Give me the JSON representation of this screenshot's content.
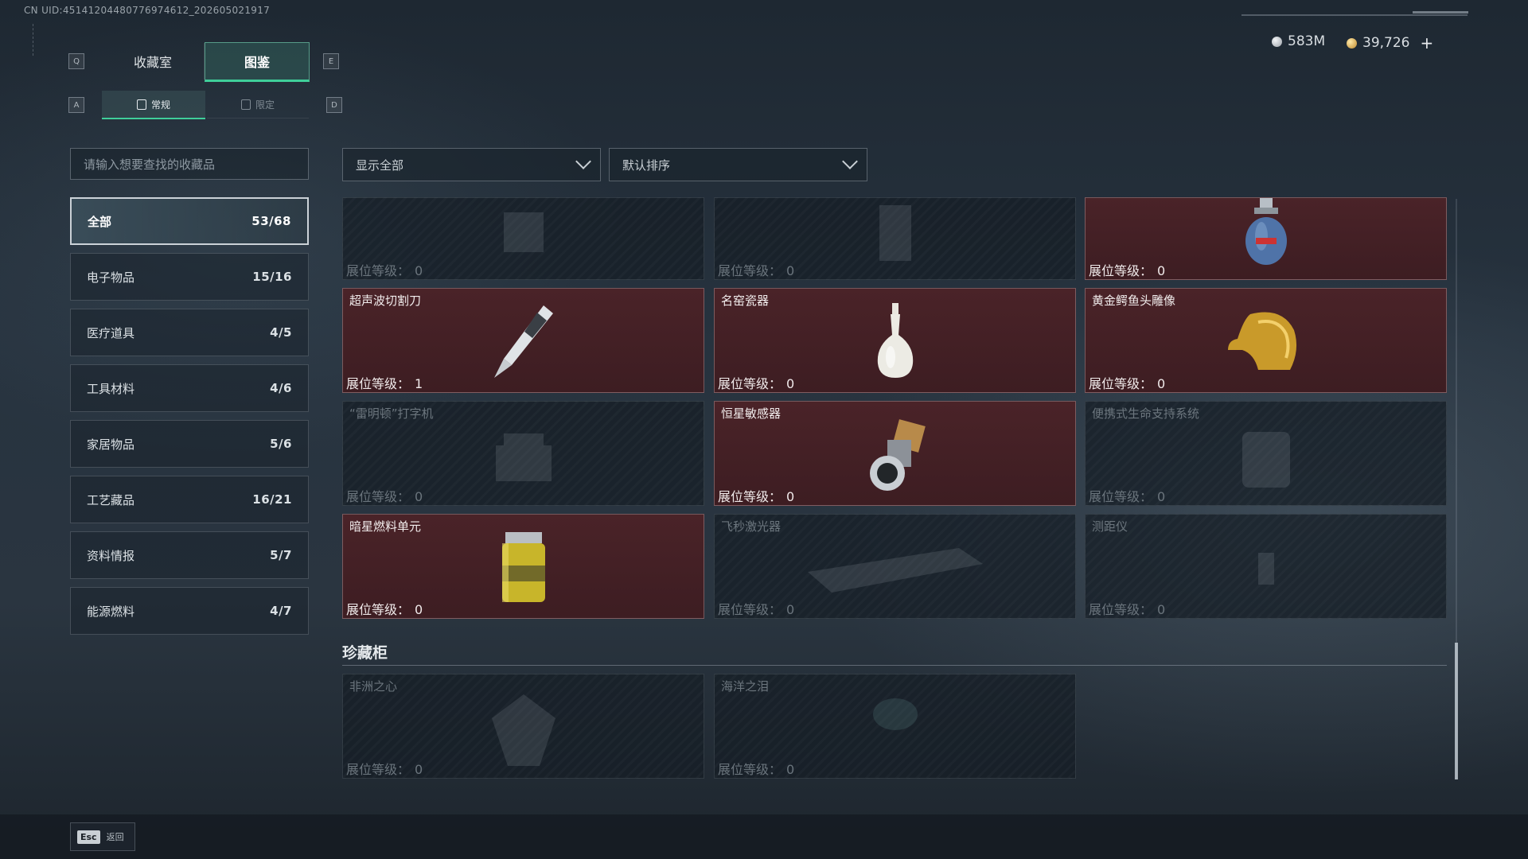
{
  "uid": "CN UID:4514120448077697461​2_202605021917",
  "currency": {
    "silver": "583M",
    "gold": "39,726",
    "plus": "+"
  },
  "keys": {
    "prev_tab": "Q",
    "next_tab": "E",
    "prev_sub": "A",
    "next_sub": "D"
  },
  "tabs": [
    {
      "label": "收藏室"
    },
    {
      "label": "图鉴"
    }
  ],
  "subtabs": [
    {
      "label": "常规"
    },
    {
      "label": "限定"
    }
  ],
  "search": {
    "placeholder": "请输入想要查找的收藏品"
  },
  "categories": [
    {
      "label": "全部",
      "count": "53/68"
    },
    {
      "label": "电子物品",
      "count": "15/16"
    },
    {
      "label": "医疗道具",
      "count": "4/5"
    },
    {
      "label": "工具材料",
      "count": "4/6"
    },
    {
      "label": "家居物品",
      "count": "5/6"
    },
    {
      "label": "工艺藏品",
      "count": "16/21"
    },
    {
      "label": "资料情报",
      "count": "5/7"
    },
    {
      "label": "能源燃料",
      "count": "4/7"
    }
  ],
  "filter": {
    "label": "显示全部"
  },
  "sort": {
    "label": "默认排序"
  },
  "level_label": "展位等级：",
  "items": [
    {
      "name": "",
      "level": "0",
      "owned": false,
      "icon": "object-silhouette-icon"
    },
    {
      "name": "",
      "level": "0",
      "owned": false,
      "icon": "object-silhouette-icon"
    },
    {
      "name": "",
      "level": "0",
      "owned": true,
      "icon": "gas-canister-icon"
    },
    {
      "name": "超声波切割刀",
      "level": "1",
      "owned": true,
      "icon": "ultrasonic-knife-icon"
    },
    {
      "name": "名窑瓷器",
      "level": "0",
      "owned": true,
      "icon": "porcelain-vase-icon"
    },
    {
      "name": "黄金鳄鱼头雕像",
      "level": "0",
      "owned": true,
      "icon": "golden-crocodile-icon"
    },
    {
      "name": "“雷明顿”打字机",
      "level": "0",
      "owned": false,
      "icon": "typewriter-icon"
    },
    {
      "name": "恒星敏感器",
      "level": "0",
      "owned": true,
      "icon": "star-sensor-icon"
    },
    {
      "name": "便携式生命支持系统",
      "level": "0",
      "owned": false,
      "icon": "life-support-icon"
    },
    {
      "name": "暗星燃料单元",
      "level": "0",
      "owned": true,
      "icon": "fuel-cell-icon"
    },
    {
      "name": "飞秒激光器",
      "level": "0",
      "owned": false,
      "icon": "laser-icon"
    },
    {
      "name": "测距仪",
      "level": "0",
      "owned": false,
      "icon": "rangefinder-icon"
    }
  ],
  "cabinet": {
    "title": "珍藏柜",
    "items": [
      {
        "name": "非洲之心",
        "level": "0",
        "owned": false,
        "icon": "diamond-icon"
      },
      {
        "name": "海洋之泪",
        "level": "0",
        "owned": false,
        "icon": "gem-icon"
      }
    ]
  },
  "footer": {
    "key": "Esc",
    "label": "返回"
  }
}
